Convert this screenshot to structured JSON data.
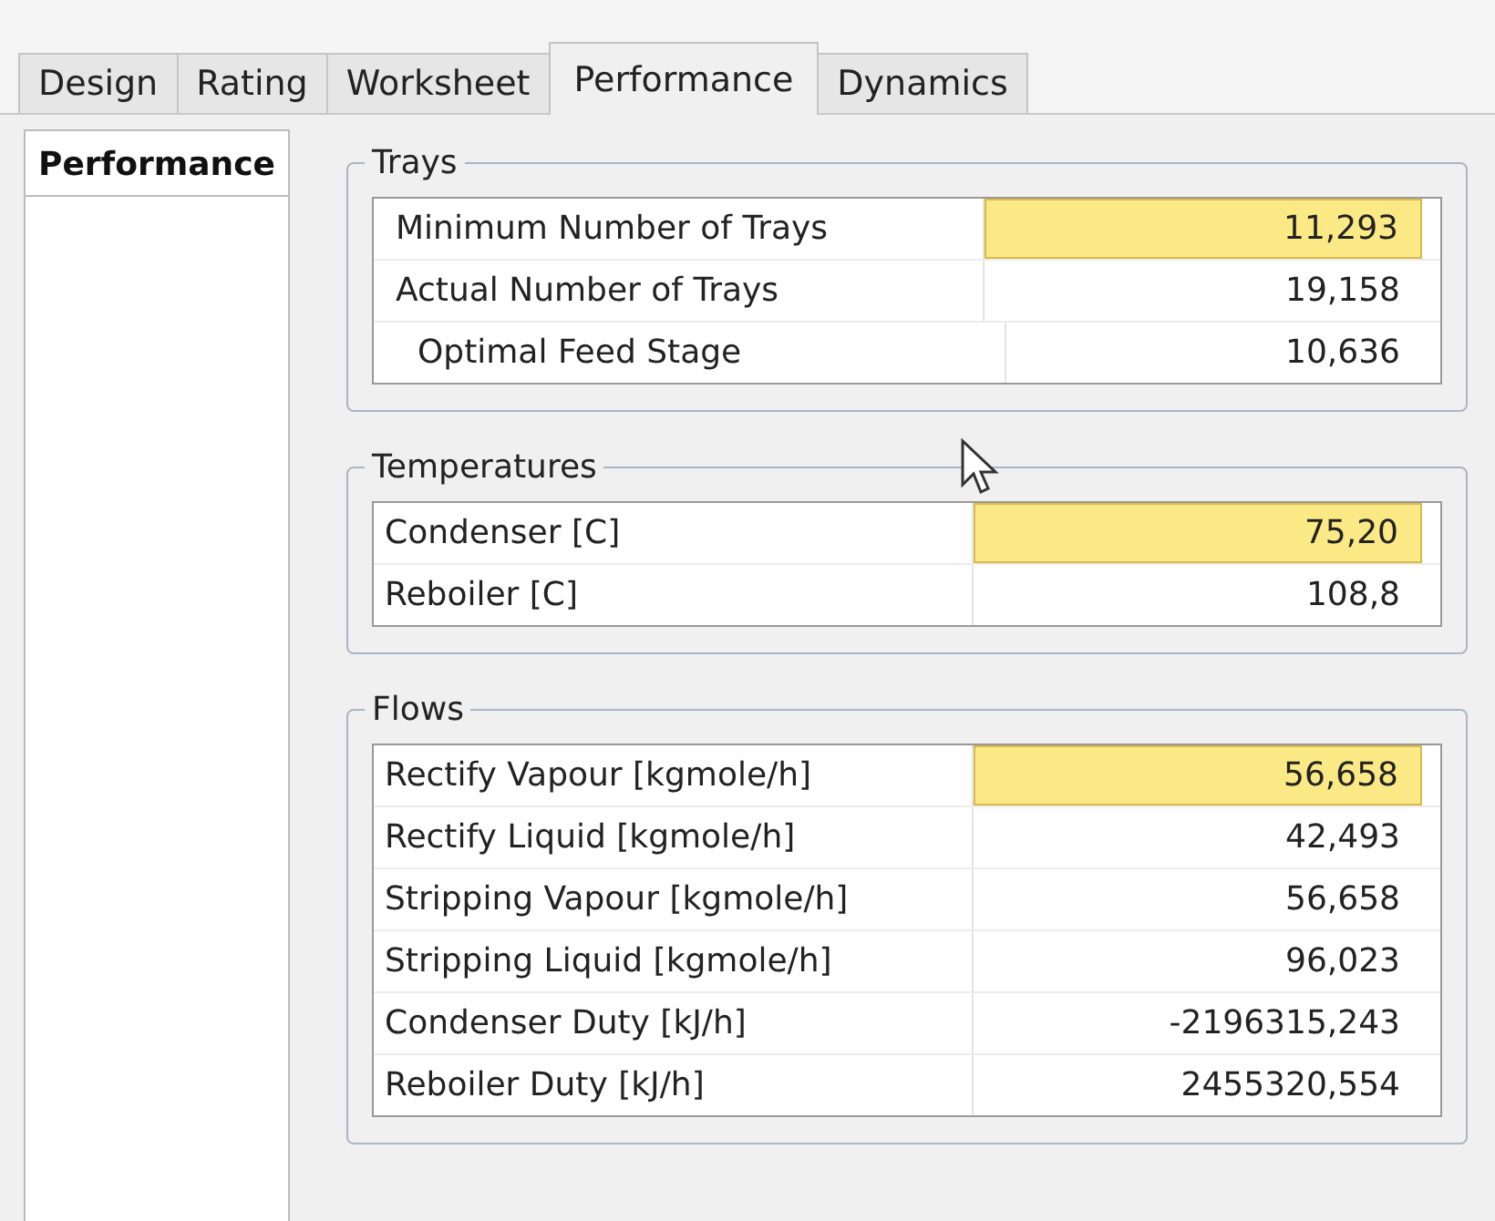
{
  "tabs": [
    {
      "label": "Design",
      "selected": false
    },
    {
      "label": "Rating",
      "selected": false
    },
    {
      "label": "Worksheet",
      "selected": false
    },
    {
      "label": "Performance",
      "selected": true
    },
    {
      "label": "Dynamics",
      "selected": false
    }
  ],
  "sidebar": {
    "tab": "Performance"
  },
  "groups": [
    {
      "title": "Trays",
      "rows": [
        {
          "label": "Minimum Number of Trays",
          "value": "11,293",
          "highlighted": true,
          "indented": false
        },
        {
          "label": "Actual Number of Trays",
          "value": "19,158",
          "highlighted": false,
          "indented": false
        },
        {
          "label": "Optimal Feed Stage",
          "value": "10,636",
          "highlighted": false,
          "indented": true
        }
      ]
    },
    {
      "title": "Temperatures",
      "rows": [
        {
          "label": "Condenser [C]",
          "value": "75,20",
          "highlighted": true,
          "indented": false
        },
        {
          "label": "Reboiler [C]",
          "value": "108,8",
          "highlighted": false,
          "indented": false
        }
      ]
    },
    {
      "title": "Flows",
      "rows": [
        {
          "label": "Rectify Vapour [kgmole/h]",
          "value": "56,658",
          "highlighted": true,
          "indented": false
        },
        {
          "label": "Rectify Liquid [kgmole/h]",
          "value": "42,493",
          "highlighted": false,
          "indented": false
        },
        {
          "label": "Stripping Vapour [kgmole/h]",
          "value": "56,658",
          "highlighted": false,
          "indented": false
        },
        {
          "label": "Stripping Liquid [kgmole/h]",
          "value": "96,023",
          "highlighted": false,
          "indented": false
        },
        {
          "label": "Condenser Duty [kJ/h]",
          "value": "-2196315,243",
          "highlighted": false,
          "indented": false
        },
        {
          "label": "Reboiler Duty [kJ/h]",
          "value": "2455320,554",
          "highlighted": false,
          "indented": false
        }
      ]
    }
  ]
}
